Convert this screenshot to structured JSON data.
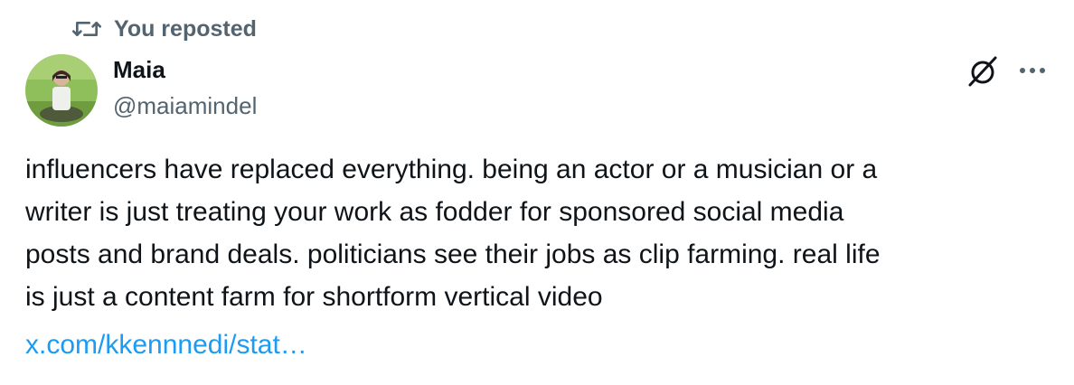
{
  "repost": {
    "label": "You reposted",
    "icon": "repost-icon"
  },
  "author": {
    "name": "Maia",
    "handle": "@maiamindel",
    "avatar_icon": "avatar"
  },
  "actions": {
    "grok_icon": "grok-icon",
    "more_icon": "more-icon"
  },
  "post": {
    "text": "influencers have replaced everything. being an actor or a musician or a\nwriter is just treating your work as fodder for sponsored social media\nposts and brand deals. politicians see their jobs as clip farming. real life\nis just a content farm for shortform vertical video",
    "link_text": "x.com/kkennnedi/stat…"
  },
  "colors": {
    "text_primary": "#0f1419",
    "text_secondary": "#536471",
    "link": "#1d9bf0"
  }
}
